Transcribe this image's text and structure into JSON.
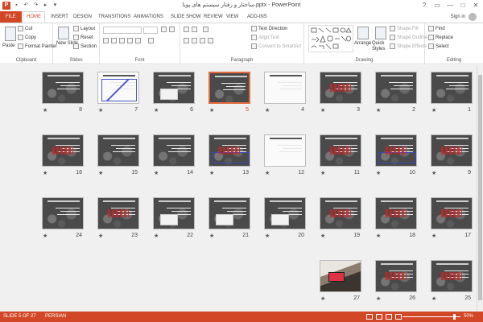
{
  "window": {
    "title": "ساختار و رفتار سیستم های پویا.pptx - PowerPoint",
    "app_icon": "P",
    "controls": [
      "?",
      "▭",
      "—",
      "□",
      "✕"
    ]
  },
  "quick_access": [
    "save-icon",
    "undo-icon",
    "redo-icon",
    "present-icon",
    "customize-icon"
  ],
  "tabs": [
    {
      "label": "FILE"
    },
    {
      "label": "HOME"
    },
    {
      "label": "INSERT"
    },
    {
      "label": "DESIGN"
    },
    {
      "label": "TRANSITIONS"
    },
    {
      "label": "ANIMATIONS"
    },
    {
      "label": "SLIDE SHOW"
    },
    {
      "label": "REVIEW"
    },
    {
      "label": "VIEW"
    },
    {
      "label": "ADD-INS"
    }
  ],
  "signin": "Sign in",
  "ribbon": {
    "clipboard": {
      "paste": "Paste",
      "cut": "Cut",
      "copy": "Copy",
      "format_painter": "Format Painter",
      "label": "Clipboard"
    },
    "slides": {
      "new_slide": "New Slide",
      "layout": "Layout",
      "reset": "Reset",
      "section": "Section",
      "label": "Slides"
    },
    "font": {
      "label": "Font"
    },
    "paragraph": {
      "text_direction": "Text Direction",
      "align_text": "Align Text",
      "convert": "Convert to SmartArt",
      "label": "Paragraph"
    },
    "drawing": {
      "arrange": "Arrange",
      "quick_styles": "Quick Styles",
      "shape_fill": "Shape Fill",
      "shape_outline": "Shape Outline",
      "shape_effects": "Shape Effects",
      "label": "Drawing"
    },
    "editing": {
      "find": "Find",
      "replace": "Replace",
      "select": "Select",
      "label": "Editing"
    }
  },
  "slides": [
    {
      "n": "1",
      "style": "dark"
    },
    {
      "n": "2",
      "style": "dark"
    },
    {
      "n": "3",
      "style": "dark-red"
    },
    {
      "n": "4",
      "style": "white"
    },
    {
      "n": "5",
      "style": "dark",
      "selected": true
    },
    {
      "n": "6",
      "style": "dark-box"
    },
    {
      "n": "7",
      "style": "white-chart"
    },
    {
      "n": "8",
      "style": "dark"
    },
    {
      "n": "9",
      "style": "dark-red"
    },
    {
      "n": "10",
      "style": "dark-blue"
    },
    {
      "n": "11",
      "style": "dark-red"
    },
    {
      "n": "12",
      "style": "white"
    },
    {
      "n": "13",
      "style": "dark-blue"
    },
    {
      "n": "14",
      "style": "dark"
    },
    {
      "n": "15",
      "style": "dark"
    },
    {
      "n": "16",
      "style": "dark-red"
    },
    {
      "n": "17",
      "style": "dark-red"
    },
    {
      "n": "18",
      "style": "dark-red"
    },
    {
      "n": "19",
      "style": "dark-red"
    },
    {
      "n": "20",
      "style": "dark-box"
    },
    {
      "n": "21",
      "style": "dark-box"
    },
    {
      "n": "22",
      "style": "dark-box"
    },
    {
      "n": "23",
      "style": "dark-red"
    },
    {
      "n": "24",
      "style": "dark"
    },
    {
      "n": "25",
      "style": "dark-red"
    },
    {
      "n": "26",
      "style": "dark-red"
    },
    {
      "n": "27",
      "style": "photo"
    }
  ],
  "status": {
    "slide_info": "SLIDE 5 OF 27",
    "language": "PERSIAN",
    "zoom": "50%"
  },
  "colors": {
    "accent": "#d24726",
    "selection": "#e46b3e"
  }
}
